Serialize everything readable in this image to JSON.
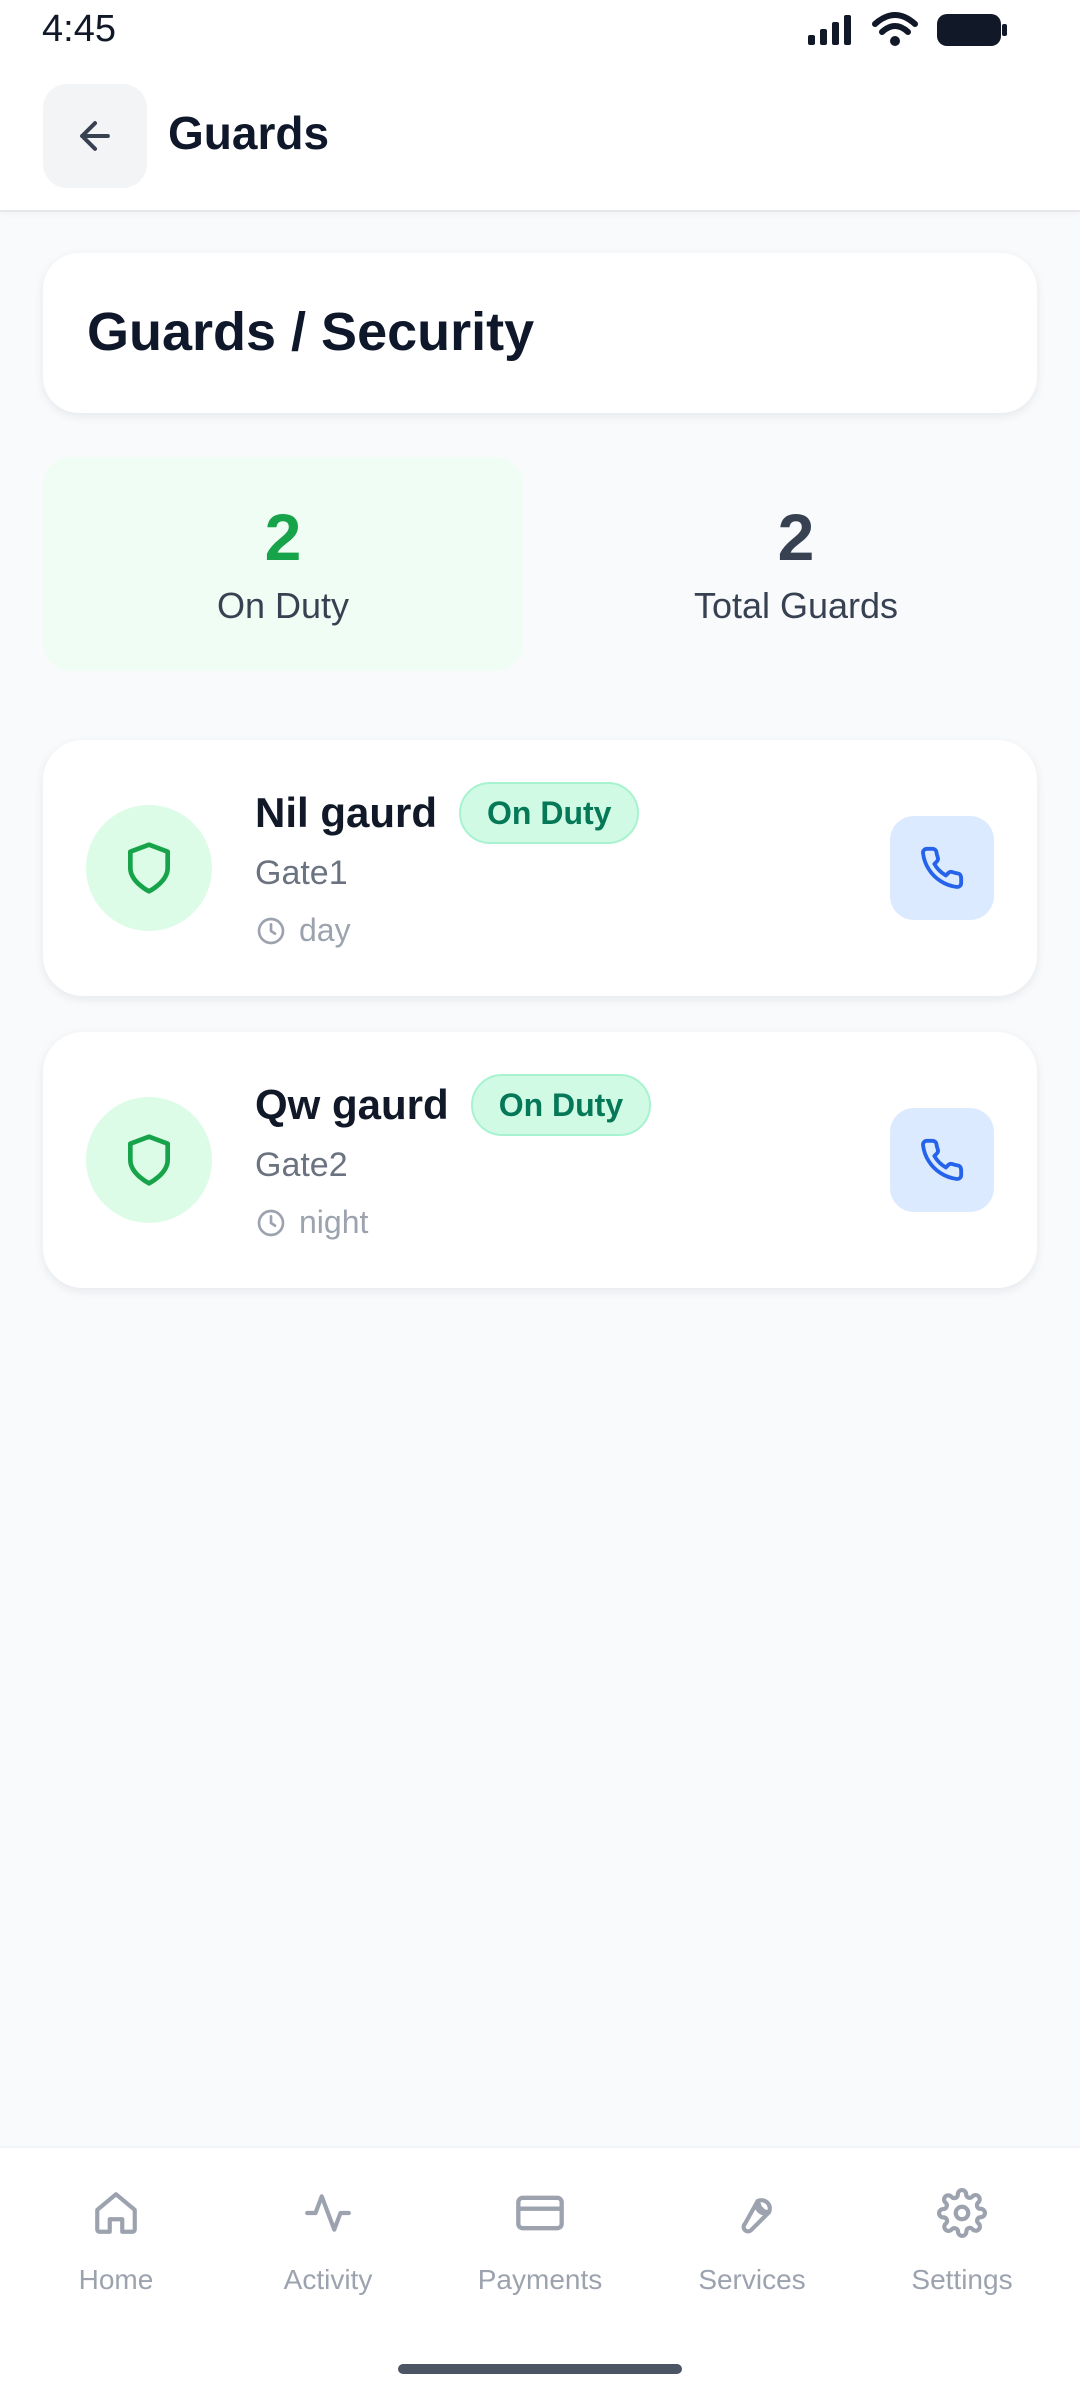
{
  "status_bar": {
    "time": "4:45"
  },
  "header": {
    "title": "Guards"
  },
  "page": {
    "title": "Guards / Security"
  },
  "stats": [
    {
      "value": "2",
      "label": "On Duty"
    },
    {
      "value": "2",
      "label": "Total Guards"
    }
  ],
  "guards": [
    {
      "name": "Nil gaurd",
      "status": "On Duty",
      "gate": "Gate1",
      "shift": "day"
    },
    {
      "name": "Qw gaurd",
      "status": "On Duty",
      "gate": "Gate2",
      "shift": "night"
    }
  ],
  "nav": [
    {
      "label": "Home",
      "icon": "home-icon"
    },
    {
      "label": "Activity",
      "icon": "activity-icon"
    },
    {
      "label": "Payments",
      "icon": "card-icon"
    },
    {
      "label": "Services",
      "icon": "wrench-icon"
    },
    {
      "label": "Settings",
      "icon": "gear-icon"
    }
  ],
  "colors": {
    "accent_green": "#16A34A",
    "badge_bg": "#D1FAE5",
    "call_bg": "#DBEAFE",
    "call_icon": "#2563EB"
  }
}
